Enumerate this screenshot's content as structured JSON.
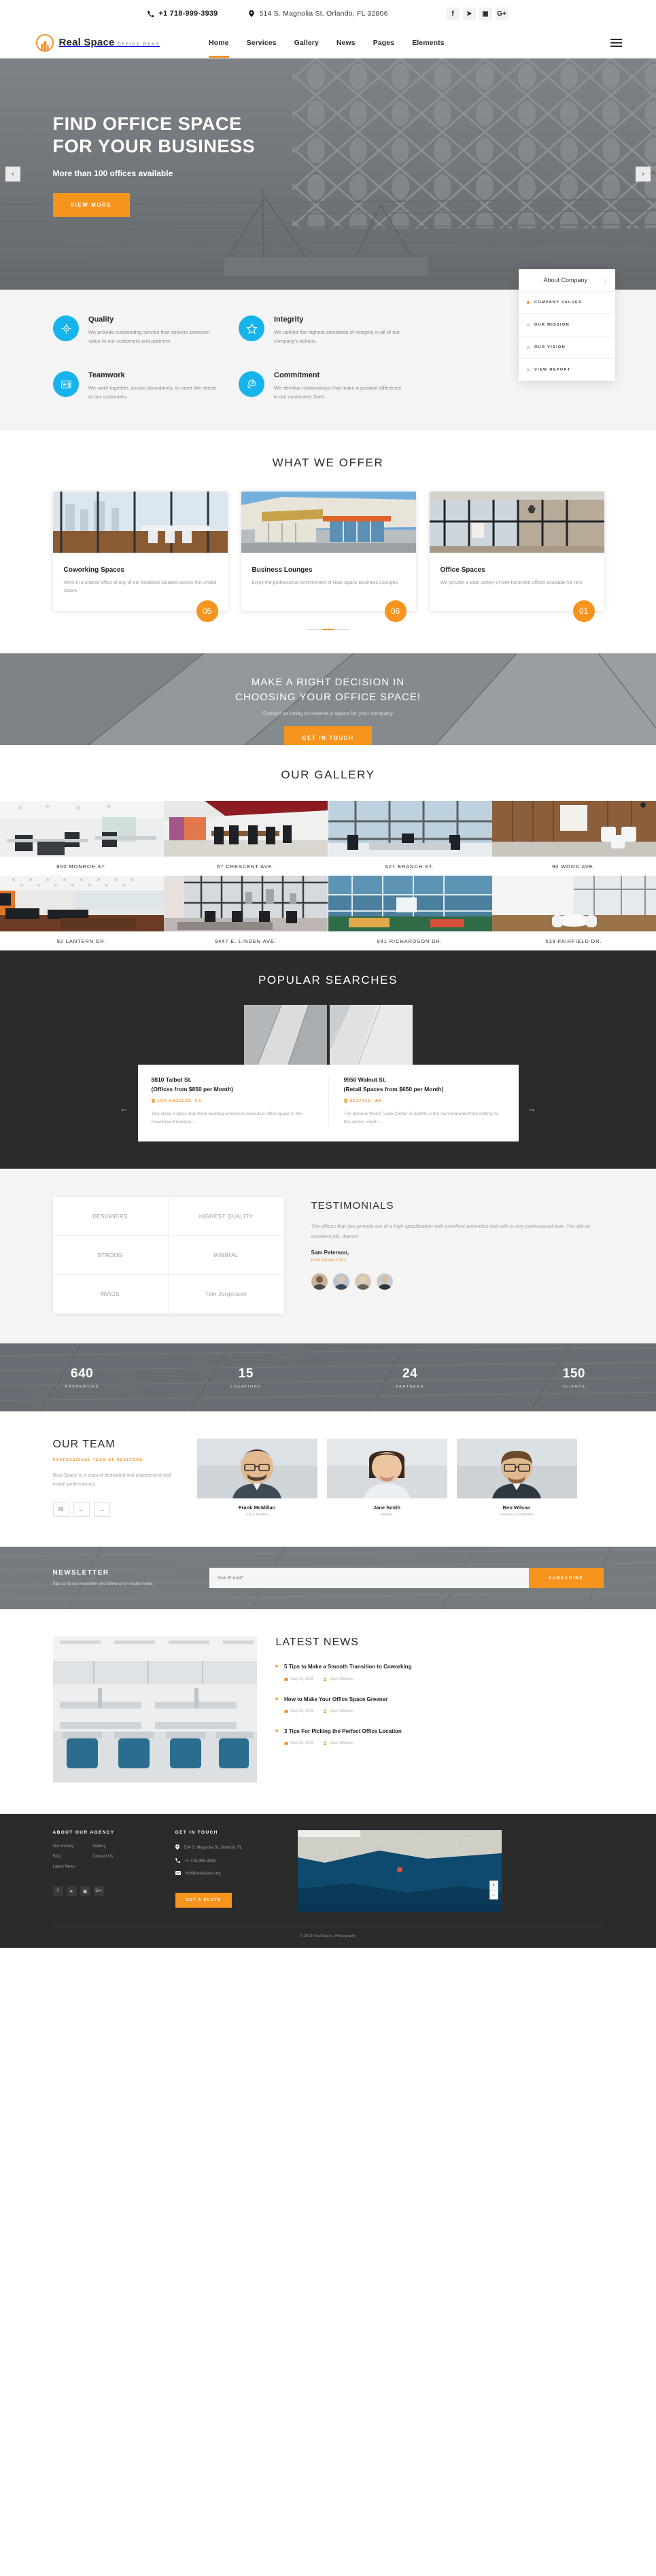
{
  "topbar": {
    "phone": "+1 718-999-3939",
    "address": "514 S. Magnolia St. Orlando, FL 32806",
    "socials": [
      {
        "name": "facebook",
        "glyph": "f"
      },
      {
        "name": "twitter",
        "glyph": "➤"
      },
      {
        "name": "instagram",
        "glyph": "▣"
      },
      {
        "name": "google-plus",
        "glyph": "G+"
      }
    ]
  },
  "brand": {
    "name": "Real Space",
    "tagline": "OFFICE RENT"
  },
  "nav": {
    "items": [
      {
        "label": "Home",
        "active": true
      },
      {
        "label": "Services",
        "active": false
      },
      {
        "label": "Gallery",
        "active": false
      },
      {
        "label": "News",
        "active": false
      },
      {
        "label": "Pages",
        "active": false
      },
      {
        "label": "Elements",
        "active": false
      }
    ]
  },
  "hero": {
    "title_line1": "FIND OFFICE SPACE",
    "title_line2": "FOR YOUR BUSINESS",
    "subtitle": "More than 100 offices available",
    "cta": "VIEW MORE",
    "prev": "‹",
    "next": "›"
  },
  "features": [
    {
      "icon": "target-icon",
      "title": "Quality",
      "text": "We provide outstanding service that delivers premium value to our customers and partners."
    },
    {
      "icon": "star-icon",
      "title": "Integrity",
      "text": "We uphold the highest standards of integrity in all of our company's actions."
    },
    {
      "icon": "id-card-icon",
      "title": "Teamwork",
      "text": "We work together, across boundaries, to meet the needs of our customers."
    },
    {
      "icon": "rocket-icon",
      "title": "Commitment",
      "text": "We develop relationships that make a positive difference in our customers' lives."
    }
  ],
  "about_card": {
    "title": "About Company",
    "items": [
      {
        "label": "COMPANY VALUES",
        "active": true
      },
      {
        "label": "OUR MISSION",
        "active": false
      },
      {
        "label": "OUR VISION",
        "active": false
      },
      {
        "label": "VIEW REPORT",
        "active": false
      }
    ]
  },
  "offer": {
    "title": "WHAT WE OFFER",
    "cards": [
      {
        "badge": "05",
        "title": "Coworking Spaces",
        "text": "Work in a shared office at any of our locations situated across the United States."
      },
      {
        "badge": "06",
        "title": "Business Lounges",
        "text": "Enjoy the professional environment of Real Space Business Lounges."
      },
      {
        "badge": "01",
        "title": "Office Spaces",
        "text": "We provide a wide variety of well-furnished offices available for rent."
      }
    ]
  },
  "cta": {
    "line1": "MAKE A RIGHT DECISION IN",
    "line2": "CHOOSING YOUR OFFICE SPACE!",
    "text": "Contact us today to reserve a space for your company.",
    "button": "GET IN TOUCH"
  },
  "gallery": {
    "title": "OUR GALLERY",
    "items": [
      "860 MONROE ST.",
      "67 CRESCENT AVE.",
      "627 BRANCH ST.",
      "90 WOOD AVE.",
      "92 LANTERN DR.",
      "9447 E. LINDEN AVE.",
      "941 RICHARDSON DR.",
      "538 FAIRFIELD DR."
    ]
  },
  "popular": {
    "title": "POPULAR SEARCHES",
    "prev": "←",
    "next": "→",
    "cards": [
      {
        "title_line1": "8810 Talbot St.",
        "title_line2": "(Offices from $850 per Month)",
        "location": "LOS ANGELES, CA",
        "text": "This class-A glass and stone building comprises executive office space in the Downtown Financial...."
      },
      {
        "title_line1": "9950 Walnut St.",
        "title_line2": "(Retail Spaces from $650 per Month)",
        "location": "SEATTLE, WA",
        "text": "The glorious World Trade Center in Seattle is the stunning waterfront setting for this center, which...."
      }
    ]
  },
  "testimonials": {
    "title": "TESTIMONIALS",
    "quote": "The offices that you provide are of a high specification with excellent amenities and with a very professional look. You did an excellent job, thanks!",
    "author": "Sam Peterson,",
    "role": "Real Space CEO",
    "brands": [
      "DESIGNERS",
      "HIGHEST QUALITY",
      "STRONG",
      "MINIMAL",
      "MIΛOS",
      "Tom Jorgensen"
    ]
  },
  "counters": [
    {
      "value": "640",
      "label": "PROPERTIES"
    },
    {
      "value": "15",
      "label": "LOCATIONS"
    },
    {
      "value": "24",
      "label": "PARTNERS"
    },
    {
      "value": "150",
      "label": "CLIENTS"
    }
  ],
  "team": {
    "title": "OUR TEAM",
    "subtitle": "PROFESSIONAL TEAM OF REALTORS",
    "text": "Real Space is a team of dedicated and experienced real estate professionals.",
    "controls": {
      "mail": "✉",
      "prev": "←",
      "next": "→"
    },
    "members": [
      {
        "name": "Frank McMillan",
        "role": "CEO, Realtor"
      },
      {
        "name": "Jane Smith",
        "role": "Realtor"
      },
      {
        "name": "Ben Wilson",
        "role": "Leasing Coordinator"
      }
    ]
  },
  "newsletter": {
    "title": "NEWSLETTER",
    "text": "Sign up to our newsletter and follow us on social media.",
    "placeholder": "Your E-mail*",
    "button": "SUBSCRIBE"
  },
  "news": {
    "title": "LATEST NEWS",
    "items": [
      {
        "title": "5 Tips to Make a Smooth Transition to Coworking",
        "date": "May 20, 2019",
        "author": "Jane Williams"
      },
      {
        "title": "How to Make Your Office Space Greener",
        "date": "May 20, 2019",
        "author": "Jane Williams"
      },
      {
        "title": "3 Tips For Picking the Perfect Office Location",
        "date": "May 20, 2019",
        "author": "Jane Williams"
      }
    ]
  },
  "footer": {
    "about_title": "ABOUT OUR AGENCY",
    "links_col1": [
      "Our History",
      "FAQ",
      "Latest News"
    ],
    "links_col2": [
      "Gallery",
      "Contact Us"
    ],
    "contact_title": "GET IN TOUCH",
    "contacts": [
      {
        "icon": "location-icon",
        "text": "514 S. Magnolia St. Orlando, FL"
      },
      {
        "icon": "phone-icon",
        "text": "+1 718-999-3939"
      },
      {
        "icon": "mail-icon",
        "text": "info@realspace.org"
      }
    ],
    "socials": [
      {
        "name": "facebook",
        "glyph": "f"
      },
      {
        "name": "twitter",
        "glyph": "➤"
      },
      {
        "name": "instagram",
        "glyph": "▣"
      },
      {
        "name": "google-plus",
        "glyph": "G+"
      }
    ],
    "button": "GET A QUOTE",
    "map_zoom_in": "+",
    "map_zoom_out": "−",
    "copyright": "© 2019 Real Space. Photography"
  }
}
